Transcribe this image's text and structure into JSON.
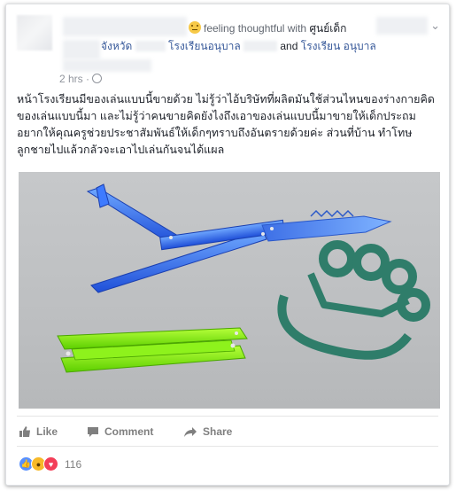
{
  "post": {
    "feeling_text": "feeling thoughtful with",
    "tagged_name": "ศูนย์เด็ก",
    "line2": {
      "place1": "จังหวัด",
      "place2": "โรงเรียนอนุบาล",
      "and_text": "and",
      "place3": "โรงเรียน อนุบาล"
    },
    "timestamp": "2 hrs ·",
    "body_text": "หน้าโรงเรียนมีของเล่นแบบนี้ขายด้วย ไม่รู้ว่าไอ้บริษัทที่ผลิตมันใช้ส่วนไหนของร่างกายคิดของเล่นแบบนี้มา และไม่รู้ว่าคนขายคิดยังไงถึงเอาของเล่นแบบนี้มาขายให้เด็กประถม อยากให้คุณครูช่วยประชาสัมพันธ์ให้เด็กๆทราบถึงอันตรายด้วยค่ะ ส่วนที่บ้าน ทำโทษลูกชายไปแล้วกลัวจะเอาไปเล่นกันจนได้แผล"
  },
  "actions": {
    "like_label": "Like",
    "comment_label": "Comment",
    "share_label": "Share"
  },
  "reactions": {
    "count": "116",
    "types": [
      "like",
      "wow",
      "love"
    ]
  },
  "colors": {
    "link": "#365899",
    "like_blue": "#5890ff",
    "wow_yellow": "#f7b928",
    "love_red": "#f33e58",
    "muted": "#90949c"
  }
}
